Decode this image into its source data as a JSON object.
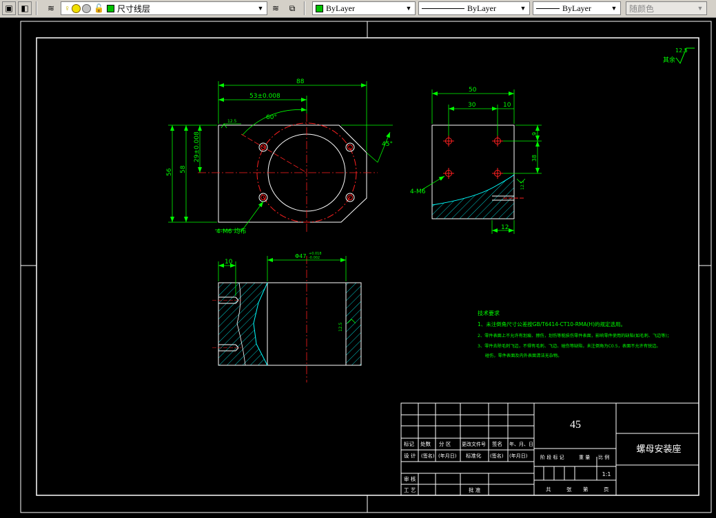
{
  "toolbar": {
    "layer_name": "尺寸线层",
    "color": "ByLayer",
    "linetype": "ByLayer",
    "lineweight": "ByLayer",
    "plot_style": "随颜色",
    "colors": {
      "layer_swatch": "#00c000",
      "color_swatch": "#00c000"
    }
  },
  "drawing": {
    "roughness_default": "12.5",
    "roughness_rest": "其余",
    "front_view": {
      "dim_88": "88",
      "dim_53": "53±0.008",
      "dim_60deg": "60°",
      "dim_45deg": "45°",
      "dim_56": "56",
      "dim_58": "58",
      "dim_29": "29±0.008",
      "roughness_small": "12.5",
      "holes_note": "4-M6 均布"
    },
    "side_view": {
      "dim_50": "50",
      "dim_30": "30",
      "dim_10": "10",
      "dim_9": "9",
      "dim_38": "38",
      "dim_12": "12",
      "holes_note": "4-M6",
      "roughness": "12.5"
    },
    "section_view": {
      "dim_10": "10",
      "dim_phi": "Φ47",
      "tol_upper": "+0.018",
      "tol_lower": "-0.002",
      "roughness": "12.5"
    },
    "tech_requirements": {
      "title": "技术要求",
      "line1": "1、未注倒角尺寸公差按GB/T6414-CT10-RMA(H)的规定选用。",
      "line2": "2、零件表面上不允许有划痕、擦伤，划伤等能损伤零件表面，影响零件使用的缺陷(如毛刺、飞边等)；",
      "line3": "3、零件去除毛刺飞边，不得有毛刺、飞边、碰伤等缺陷，未注倒角为C0.5，表面不允许有锐边。",
      "line4": "碰伤，零件表面及内外表面清洁无杂物。"
    },
    "title_block": {
      "material": "45",
      "part_name": "螺母安装座",
      "scale": "1:1",
      "h_mark": "标记",
      "h_count": "处数",
      "h_zone": "分 区",
      "h_docno": "更改文件号",
      "h_sign": "签名",
      "h_date": "年、月、日",
      "design": "设 计",
      "sign1": "(签名)",
      "date1": "(年月日)",
      "standard": "标准化",
      "sign2": "(签名)",
      "date2": "(年月日)",
      "stage_mark": "阶 段 标 记",
      "weight": "重 量",
      "ratio": "比 例",
      "review": "审 核",
      "process": "工 艺",
      "approve": "批 准",
      "total": "共",
      "sheets": "张",
      "sheet_no": "第",
      "page": "页"
    }
  }
}
